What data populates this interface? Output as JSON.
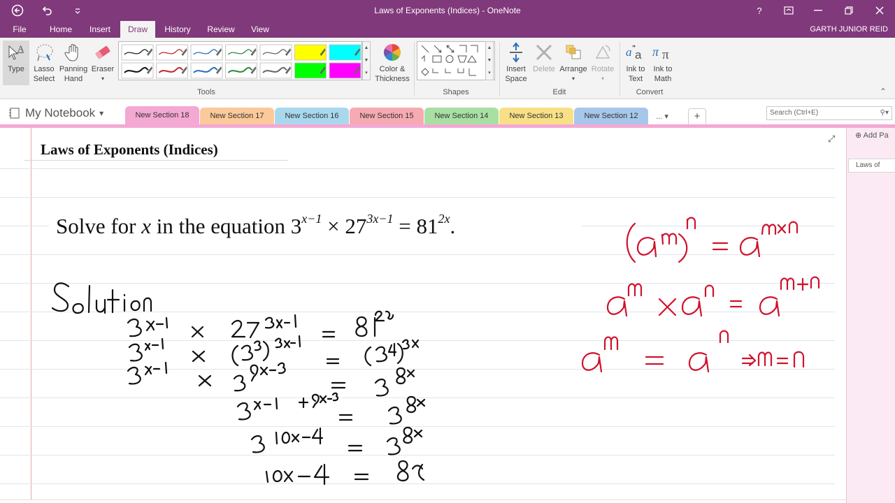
{
  "titlebar": {
    "title": "Laws of Exponents (Indices) - OneNote",
    "help": "?",
    "ribbon_options": "⊡",
    "restore": "❐",
    "close": "✕"
  },
  "menu": {
    "tabs": [
      {
        "label": "File"
      },
      {
        "label": "Home"
      },
      {
        "label": "Insert"
      },
      {
        "label": "Draw"
      },
      {
        "label": "History"
      },
      {
        "label": "Review"
      },
      {
        "label": "View"
      }
    ],
    "active": "Draw",
    "user": "GARTH JUNIOR REID"
  },
  "ribbon": {
    "type": {
      "label": "Type"
    },
    "lasso": {
      "label1": "Lasso",
      "label2": "Select"
    },
    "panning": {
      "label1": "Panning",
      "label2": "Hand"
    },
    "eraser": {
      "label": "Eraser",
      "arrow": "▾"
    },
    "color_thickness": {
      "label1": "Color &",
      "label2": "Thickness"
    },
    "insert_space": {
      "label1": "Insert",
      "label2": "Space"
    },
    "delete": {
      "label": "Delete"
    },
    "arrange": {
      "label": "Arrange",
      "arrow": "▾"
    },
    "rotate": {
      "label": "Rotate",
      "arrow": "▾"
    },
    "ink_to_text": {
      "label1": "Ink to",
      "label2": "Text"
    },
    "ink_to_math": {
      "label1": "Ink to",
      "label2": "Math"
    },
    "groups": {
      "tools": "Tools",
      "shapes": "Shapes",
      "edit": "Edit",
      "convert": "Convert"
    },
    "pens": [
      {
        "color": "#222222",
        "highlighter": false
      },
      {
        "color": "#c0282d",
        "highlighter": false
      },
      {
        "color": "#2c6fb7",
        "highlighter": false
      },
      {
        "color": "#2a8a3c",
        "highlighter": false
      },
      {
        "color": "#666666",
        "highlighter": false
      },
      {
        "color": "#ffff00",
        "highlighter": true
      },
      {
        "color": "#00ffff",
        "highlighter": true
      },
      {
        "color": "#111111",
        "highlighter": false
      },
      {
        "color": "#c0282d",
        "highlighter": false
      },
      {
        "color": "#2c6fb7",
        "highlighter": false
      },
      {
        "color": "#2a8a3c",
        "highlighter": false
      },
      {
        "color": "#666666",
        "highlighter": false
      },
      {
        "color": "#00ff00",
        "highlighter": true
      },
      {
        "color": "#ff00ff",
        "highlighter": true
      }
    ],
    "collapse": "⌃"
  },
  "notebook": {
    "name": "My Notebook",
    "arrow": "▾",
    "sections": [
      {
        "label": "New Section 18",
        "color": "#f4a8d4"
      },
      {
        "label": "New Section 17",
        "color": "#fbc99a"
      },
      {
        "label": "New Section 16",
        "color": "#a9d8ee"
      },
      {
        "label": "New Section 15",
        "color": "#f6aab1"
      },
      {
        "label": "New Section 14",
        "color": "#a8e0a4"
      },
      {
        "label": "New Section 13",
        "color": "#f9e087"
      },
      {
        "label": "New Section 12",
        "color": "#a7c7ea"
      }
    ],
    "more": "... ▾",
    "add": "+",
    "search_placeholder": "Search (Ctrl+E)",
    "search_icon": "⚲▾"
  },
  "page": {
    "title": "Laws of Exponents (Indices)",
    "expand": "⤢",
    "problem": {
      "prefix": "Solve for ",
      "var": "x",
      "mid": " in the equation 3",
      "exp1": "x−1",
      "times": " × 27",
      "exp2": "3x−1",
      "eq": " = 81",
      "exp3": "2x",
      "end": "."
    }
  },
  "pages_pane": {
    "add_page": "Add Pa",
    "add_icon": "⊕",
    "items": [
      {
        "label": "Laws of"
      }
    ]
  },
  "colors": {
    "accent": "#80397b",
    "ink_black": "#111111",
    "ink_red": "#d0122c",
    "active_section": "#f4a8d4"
  }
}
